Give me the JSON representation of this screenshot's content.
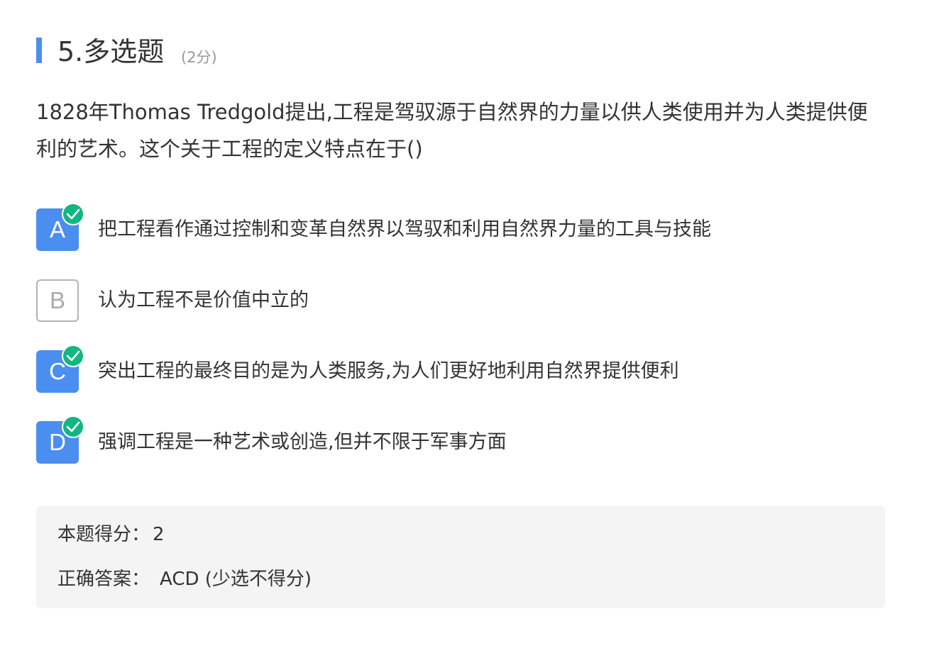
{
  "question": {
    "title": "5.多选题",
    "score": "(2分)",
    "stem": "1828年Thomas Tredgold提出,工程是驾驭源于自然界的力量以供人类使用并为人类提供便利的艺术。这个关于工程的定义特点在于()"
  },
  "options": [
    {
      "letter": "A",
      "text": "把工程看作通过控制和变革自然界以驾驭和利用自然界力量的工具与技能",
      "selected": true,
      "icon": "check-icon"
    },
    {
      "letter": "B",
      "text": "认为工程不是价值中立的",
      "selected": false
    },
    {
      "letter": "C",
      "text": "突出工程的最终目的是为人类服务,为人们更好地利用自然界提供便利",
      "selected": true,
      "icon": "check-icon"
    },
    {
      "letter": "D",
      "text": "强调工程是一种艺术或创造,但并不限于军事方面",
      "selected": true,
      "icon": "check-icon"
    }
  ],
  "result": {
    "score_label": "本题得分：",
    "score_value": "2",
    "answer_label": "正确答案：",
    "answer_value": "ACD (少选不得分)"
  },
  "colors": {
    "accent": "#4a8ef0",
    "check": "#11b681",
    "result_bg": "#f4f4f4"
  }
}
